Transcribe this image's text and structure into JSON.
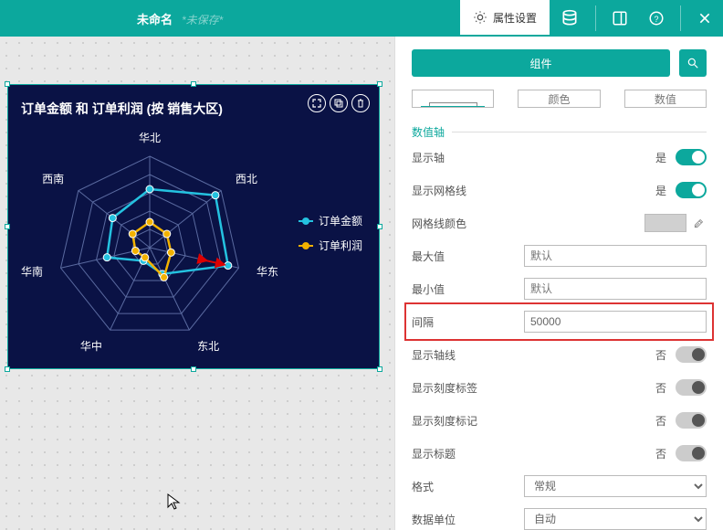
{
  "header": {
    "title": "未命名",
    "unsaved": "*未保存*",
    "tab_properties": "属性设置"
  },
  "chart": {
    "title": "订单金额 和 订单利润 (按 销售大区)"
  },
  "legend": {
    "series1": "订单金额",
    "series2": "订单利润"
  },
  "axes": {
    "n": "华北",
    "ne": "西北",
    "e": "华东",
    "se": "东北",
    "s": "华中",
    "sw": "华南",
    "w": "西南"
  },
  "panel": {
    "component_btn": "组件",
    "tab1": "颜色",
    "tab2": "数值",
    "section_numeric_axis": "数值轴",
    "show_axis": "显示轴",
    "show_axis_val": "是",
    "show_grid": "显示网格线",
    "show_grid_val": "是",
    "grid_color": "网格线颜色",
    "max": "最大值",
    "max_ph": "默认",
    "min": "最小值",
    "min_ph": "默认",
    "interval": "间隔",
    "interval_val": "50000",
    "show_axis_line": "显示轴线",
    "show_axis_line_val": "否",
    "show_tick_label": "显示刻度标签",
    "show_tick_label_val": "否",
    "show_tick_mark": "显示刻度标记",
    "show_tick_mark_val": "否",
    "show_title": "显示标题",
    "show_title_val": "否",
    "format": "格式",
    "format_val": "常规",
    "data_unit": "数据单位",
    "data_unit_val": "自动"
  },
  "chart_data": {
    "type": "radar",
    "title": "订单金额 和 订单利润 (按 销售大区)",
    "categories": [
      "华北",
      "西北",
      "华东",
      "东北",
      "华中",
      "华南",
      "西南"
    ],
    "interval": 50000,
    "rings": 5,
    "max": 250000,
    "series": [
      {
        "name": "订单金额",
        "color": "#24c2e0",
        "values": [
          160000,
          230000,
          220000,
          80000,
          40000,
          120000,
          130000
        ]
      },
      {
        "name": "订单利润",
        "color": "#f3b200",
        "values": [
          70000,
          60000,
          60000,
          90000,
          30000,
          40000,
          60000
        ]
      }
    ]
  }
}
